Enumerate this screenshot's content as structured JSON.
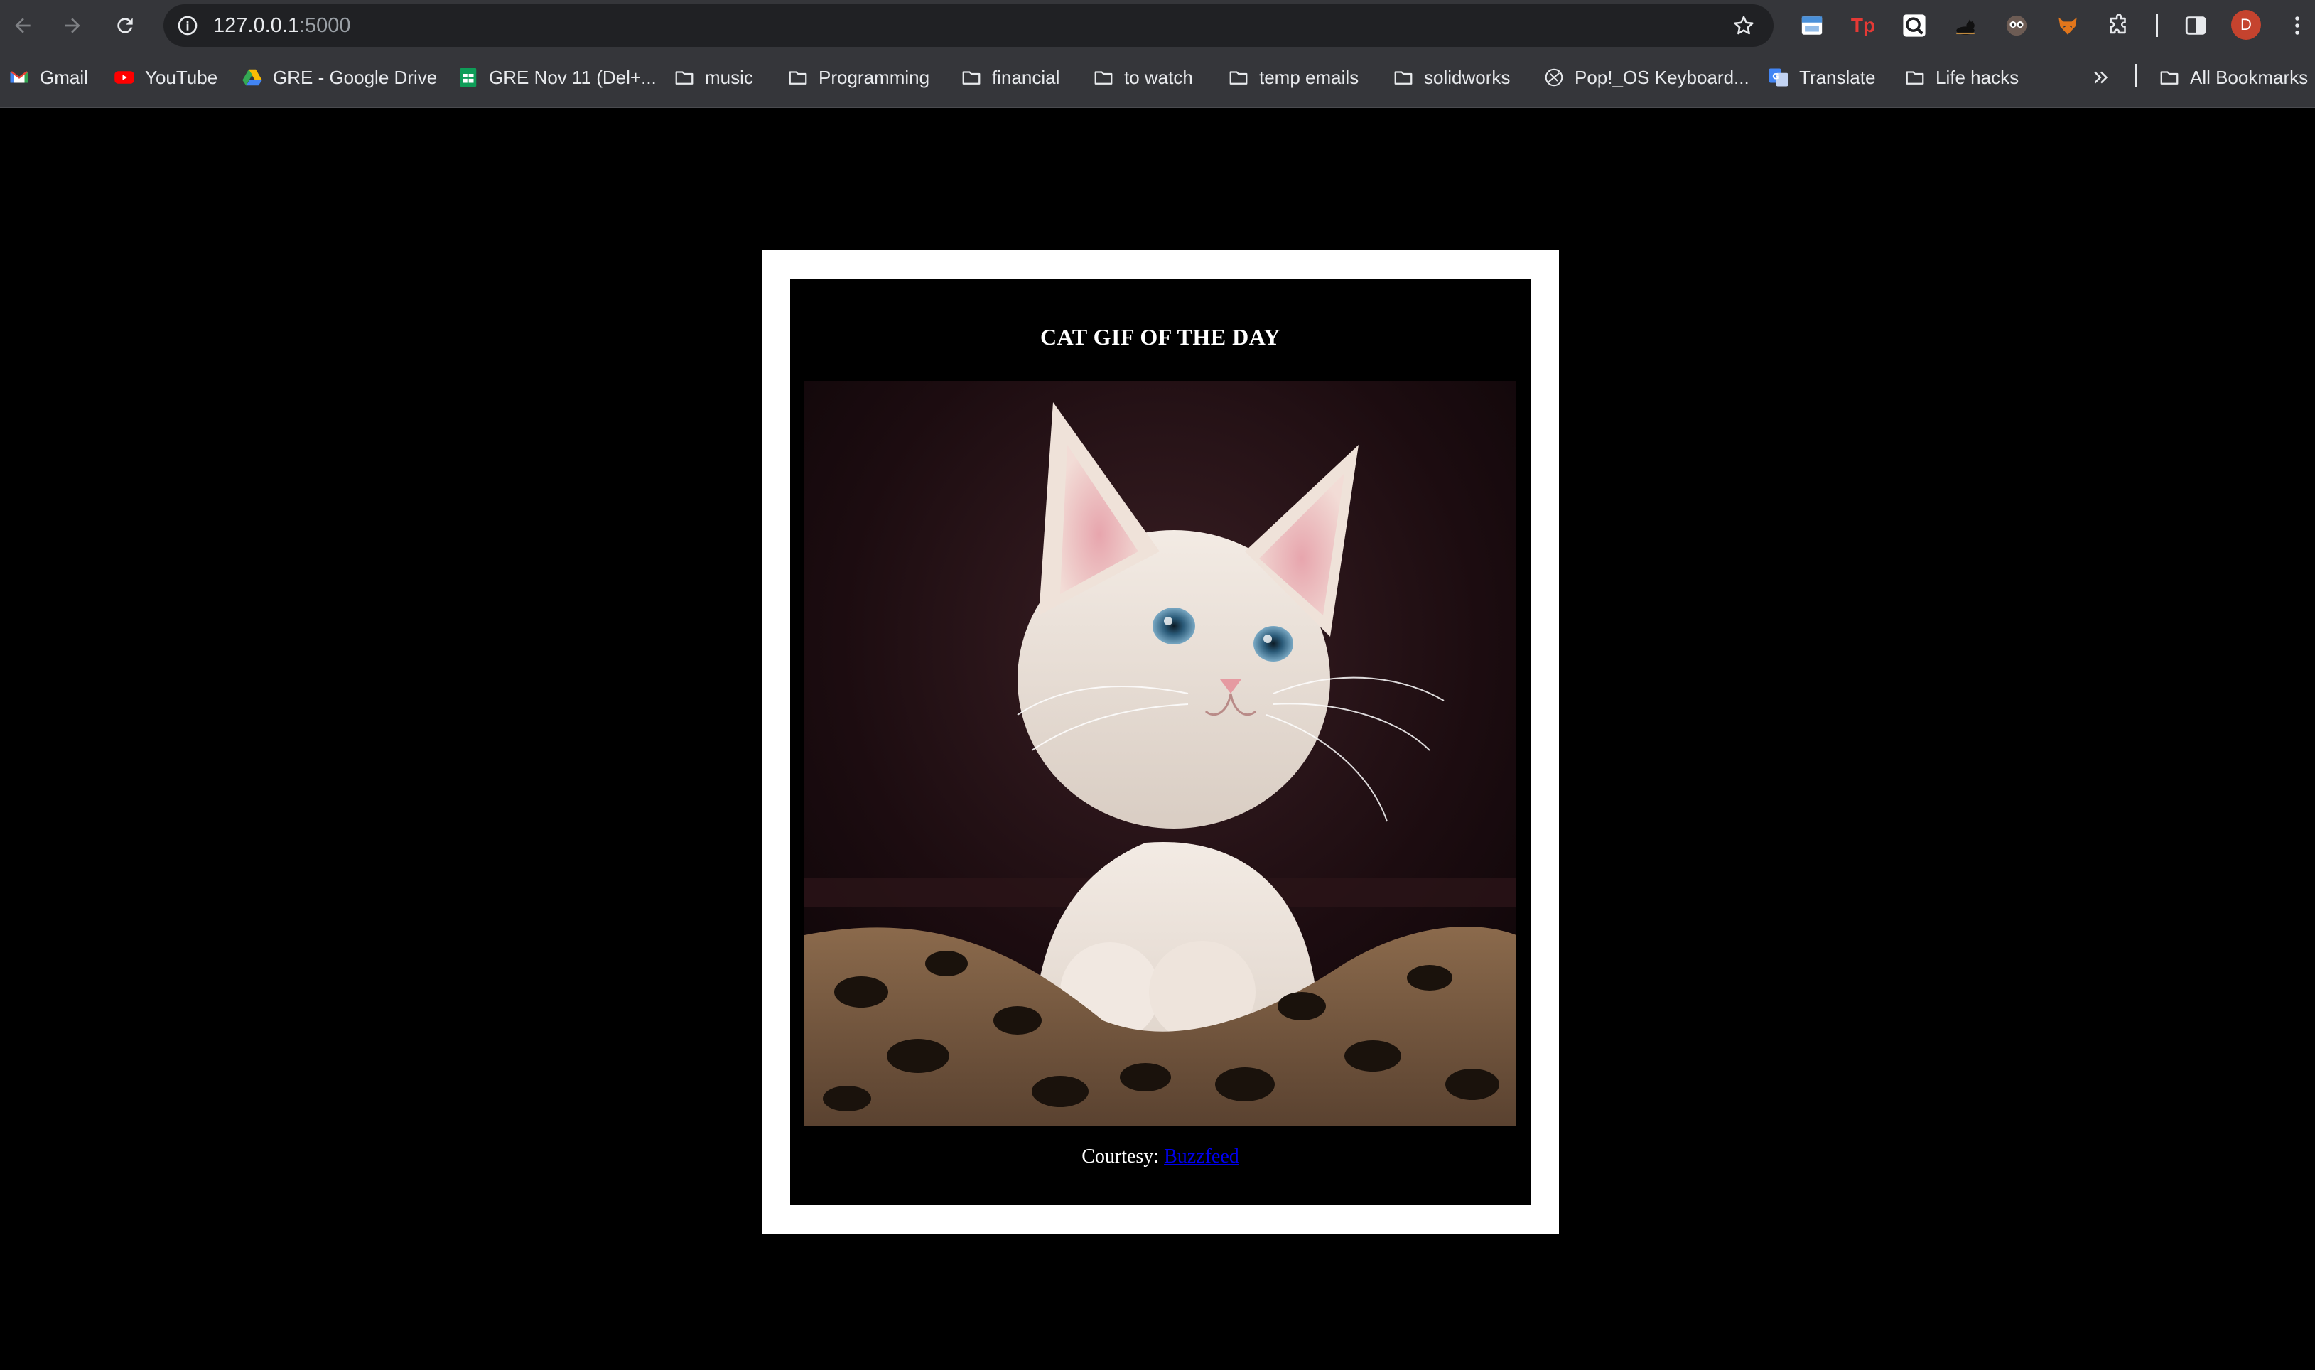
{
  "browser": {
    "url_host": "127.0.0.1",
    "url_port": ":5000",
    "avatar_initial": "D",
    "extensions": [
      {
        "name": "calendar-extension-icon",
        "color": "#4a90d9",
        "glyph": ""
      },
      {
        "name": "tp-extension-icon",
        "color": "#35363a",
        "glyph": "Tp"
      },
      {
        "name": "zoom-extension-icon",
        "color": "#ffffff",
        "glyph": ""
      },
      {
        "name": "cat-extension-icon",
        "color": "#35363a",
        "glyph": ""
      },
      {
        "name": "eyes-extension-icon",
        "color": "#35363a",
        "glyph": ""
      },
      {
        "name": "fox-extension-icon",
        "color": "#35363a",
        "glyph": ""
      }
    ]
  },
  "bookmarks": [
    {
      "label": "Gmail",
      "icon": "gmail-icon"
    },
    {
      "label": "YouTube",
      "icon": "youtube-icon"
    },
    {
      "label": "GRE - Google Drive",
      "icon": "google-drive-icon"
    },
    {
      "label": "GRE Nov 11 (Del+...",
      "icon": "google-sheets-icon"
    },
    {
      "label": "music",
      "icon": "folder-icon"
    },
    {
      "label": "Programming",
      "icon": "folder-icon"
    },
    {
      "label": "financial",
      "icon": "folder-icon"
    },
    {
      "label": "to watch",
      "icon": "folder-icon"
    },
    {
      "label": "temp emails",
      "icon": "folder-icon"
    },
    {
      "label": "solidworks",
      "icon": "folder-icon"
    },
    {
      "label": "Pop!_OS Keyboard...",
      "icon": "keyboard-site-icon"
    },
    {
      "label": "Translate",
      "icon": "translate-icon"
    },
    {
      "label": "Life hacks",
      "icon": "folder-icon"
    }
  ],
  "all_bookmarks_label": "All Bookmarks",
  "page": {
    "title": "CAT GIF OF THE DAY",
    "courtesy_prefix": "Courtesy:",
    "courtesy_link": "Buzzfeed",
    "colors": {
      "page_bg": "#000000",
      "frame": "#ffffff",
      "link": "#0000ee"
    }
  }
}
